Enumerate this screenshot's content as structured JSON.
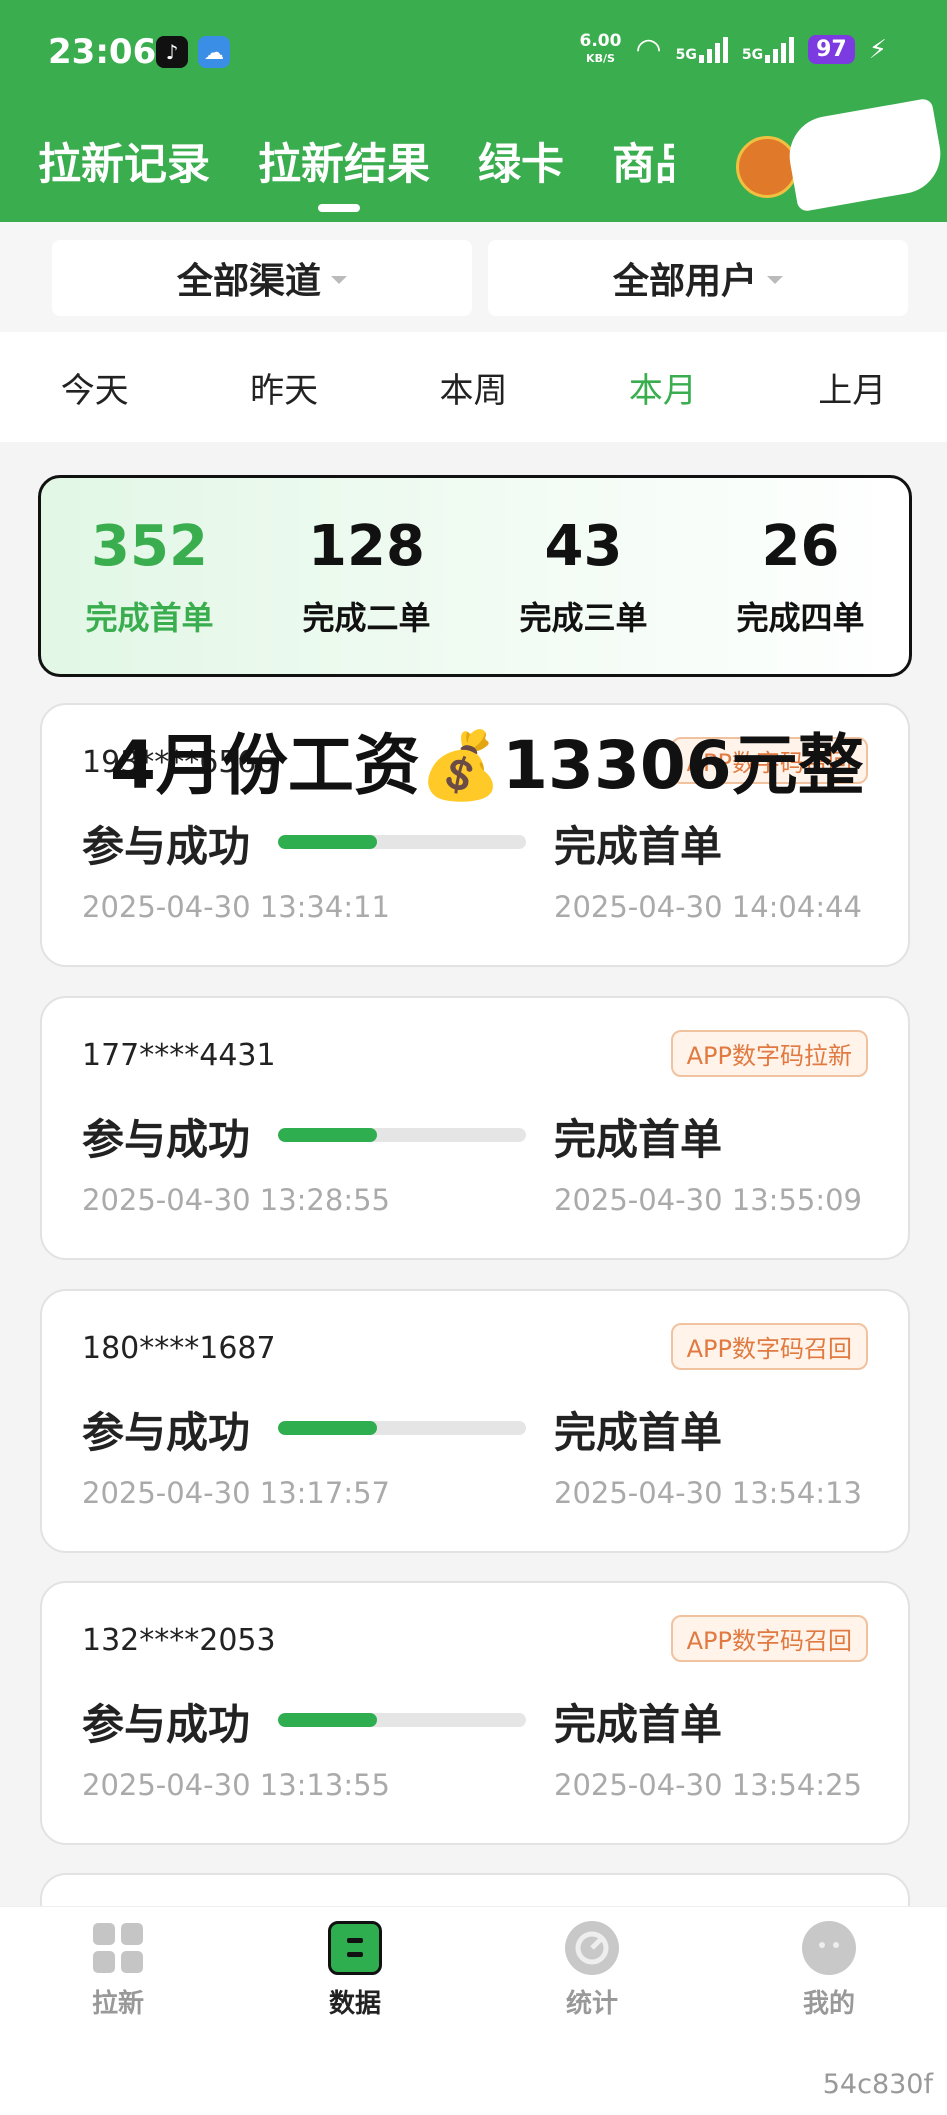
{
  "status_bar": {
    "time": "23:06",
    "speed": "6.00",
    "speed_unit": "KB/S",
    "network1": "5G",
    "network2": "5G",
    "battery": "97"
  },
  "header": {
    "tabs": [
      "拉新记录",
      "拉新结果",
      "绿卡",
      "商品"
    ],
    "active_tab": 1,
    "accent_color": "#3aad4f"
  },
  "filters": {
    "channel": "全部渠道",
    "user": "全部用户"
  },
  "periods": {
    "items": [
      "今天",
      "昨天",
      "本周",
      "本月",
      "上月"
    ],
    "active": 3
  },
  "summary": [
    {
      "value": "352",
      "label": "完成首单"
    },
    {
      "value": "128",
      "label": "完成二单"
    },
    {
      "value": "43",
      "label": "完成三单"
    },
    {
      "value": "26",
      "label": "完成四单"
    }
  ],
  "overlay_text": "4月份工资💰13306元整",
  "records": [
    {
      "phone": "193****6566",
      "tag": "APP数字码召回",
      "status_left": "参与成功",
      "status_right": "完成首单",
      "time_left": "2025-04-30 13:34:11",
      "time_right": "2025-04-30 14:04:44",
      "progress": 0.4
    },
    {
      "phone": "177****4431",
      "tag": "APP数字码拉新",
      "status_left": "参与成功",
      "status_right": "完成首单",
      "time_left": "2025-04-30 13:28:55",
      "time_right": "2025-04-30 13:55:09",
      "progress": 0.4
    },
    {
      "phone": "180****1687",
      "tag": "APP数字码召回",
      "status_left": "参与成功",
      "status_right": "完成首单",
      "time_left": "2025-04-30 13:17:57",
      "time_right": "2025-04-30 13:54:13",
      "progress": 0.4
    },
    {
      "phone": "132****2053",
      "tag": "APP数字码召回",
      "status_left": "参与成功",
      "status_right": "完成首单",
      "time_left": "2025-04-30 13:13:55",
      "time_right": "2025-04-30 13:54:25",
      "progress": 0.4
    }
  ],
  "bottom_nav": [
    {
      "label": "拉新",
      "icon": "grid-icon"
    },
    {
      "label": "数据",
      "icon": "data-icon"
    },
    {
      "label": "统计",
      "icon": "chart-icon"
    },
    {
      "label": "我的",
      "icon": "profile-icon"
    }
  ],
  "bottom_nav_active": 1,
  "watermark": "54c830f"
}
